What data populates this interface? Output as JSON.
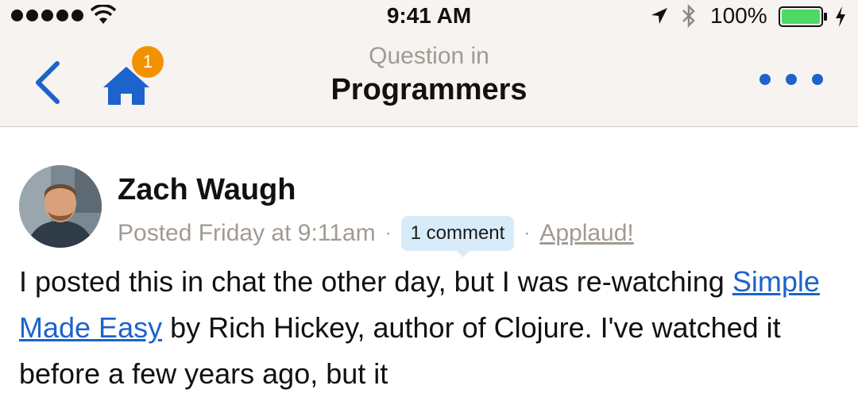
{
  "status_bar": {
    "time": "9:41 AM",
    "battery_percent": "100%",
    "signal_dots": 5,
    "icons": [
      "wifi-icon",
      "location-icon",
      "bluetooth-icon",
      "battery-icon",
      "charging-icon"
    ],
    "battery_color": "#4cd964"
  },
  "nav": {
    "subtitle": "Question in",
    "title": "Programmers",
    "badge_count": "1",
    "accent_color": "#1c63cc",
    "badge_color": "#f39200",
    "icons": [
      "back-chevron-icon",
      "home-icon",
      "more-dots-icon"
    ]
  },
  "post": {
    "author": "Zach Waugh",
    "posted": "Posted Friday at 9:11am",
    "separator": "·",
    "comments_label": "1 comment",
    "applaud_label": "Applaud!",
    "body_before_link": "I posted this in chat the other day, but I was re-watching ",
    "link_text": "Simple Made Easy",
    "body_after_link": " by Rich Hickey, author of Clojure. I've watched it before a few years ago, but it"
  }
}
